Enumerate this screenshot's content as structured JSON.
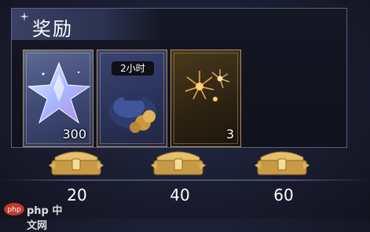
{
  "panel": {
    "title": "奖励",
    "rewards": [
      {
        "icon": "crystal-star-icon",
        "quantity": "300"
      },
      {
        "icon": "treasure-bag-icon",
        "duration": "2小时"
      },
      {
        "icon": "fireworks-icon",
        "quantity": "3"
      }
    ]
  },
  "milestones": [
    {
      "chest_icon": "gold-chest-icon",
      "value": "20"
    },
    {
      "chest_icon": "gold-chest-icon",
      "value": "40"
    },
    {
      "chest_icon": "gold-chest-icon",
      "value": "60"
    }
  ],
  "watermark": {
    "text": "php 中文网"
  },
  "colors": {
    "card_border": "#a9905e",
    "panel_border": "#5b6280",
    "gold": "#d9b25e"
  }
}
